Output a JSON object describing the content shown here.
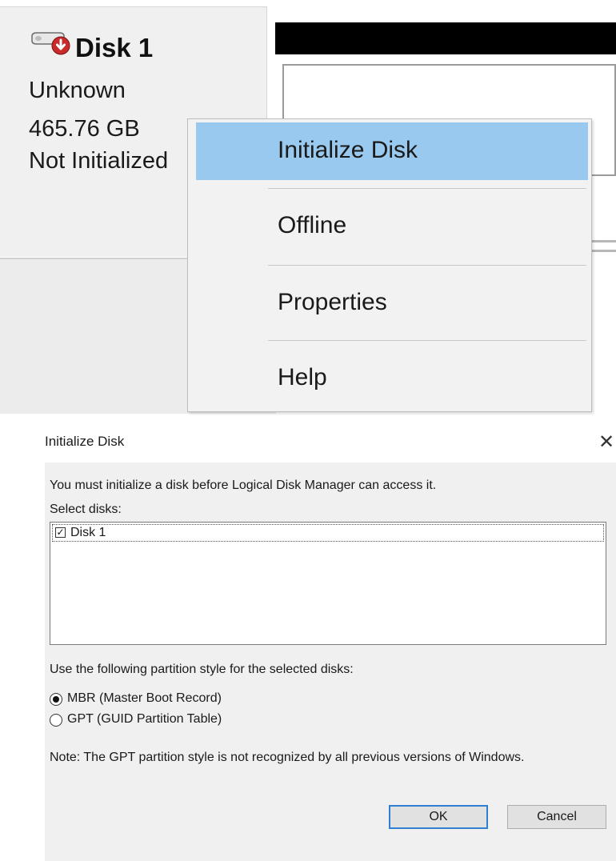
{
  "disk_panel": {
    "name": "Disk 1",
    "type": "Unknown",
    "size": "465.76 GB",
    "status": "Not Initialized",
    "icon": "disk-error-icon"
  },
  "context_menu": {
    "items": [
      {
        "label": "Initialize Disk",
        "highlighted": true
      },
      {
        "label": "Offline",
        "highlighted": false
      },
      {
        "label": "Properties",
        "highlighted": false
      },
      {
        "label": "Help",
        "highlighted": false
      }
    ],
    "highlight_color": "#99c9ef"
  },
  "dialog": {
    "title": "Initialize Disk",
    "close_icon": "close-icon",
    "message": "You must initialize a disk before Logical Disk Manager can access it.",
    "select_label": "Select disks:",
    "disks": [
      {
        "label": "Disk 1",
        "checked": true
      }
    ],
    "partition_label": "Use the following partition style for the selected disks:",
    "options": [
      {
        "label": "MBR (Master Boot Record)",
        "selected": true
      },
      {
        "label": "GPT (GUID Partition Table)",
        "selected": false
      }
    ],
    "note": "Note: The GPT partition style is not recognized by all previous versions of Windows.",
    "ok_label": "OK",
    "cancel_label": "Cancel",
    "ok_border_color": "#2f7fd3"
  }
}
